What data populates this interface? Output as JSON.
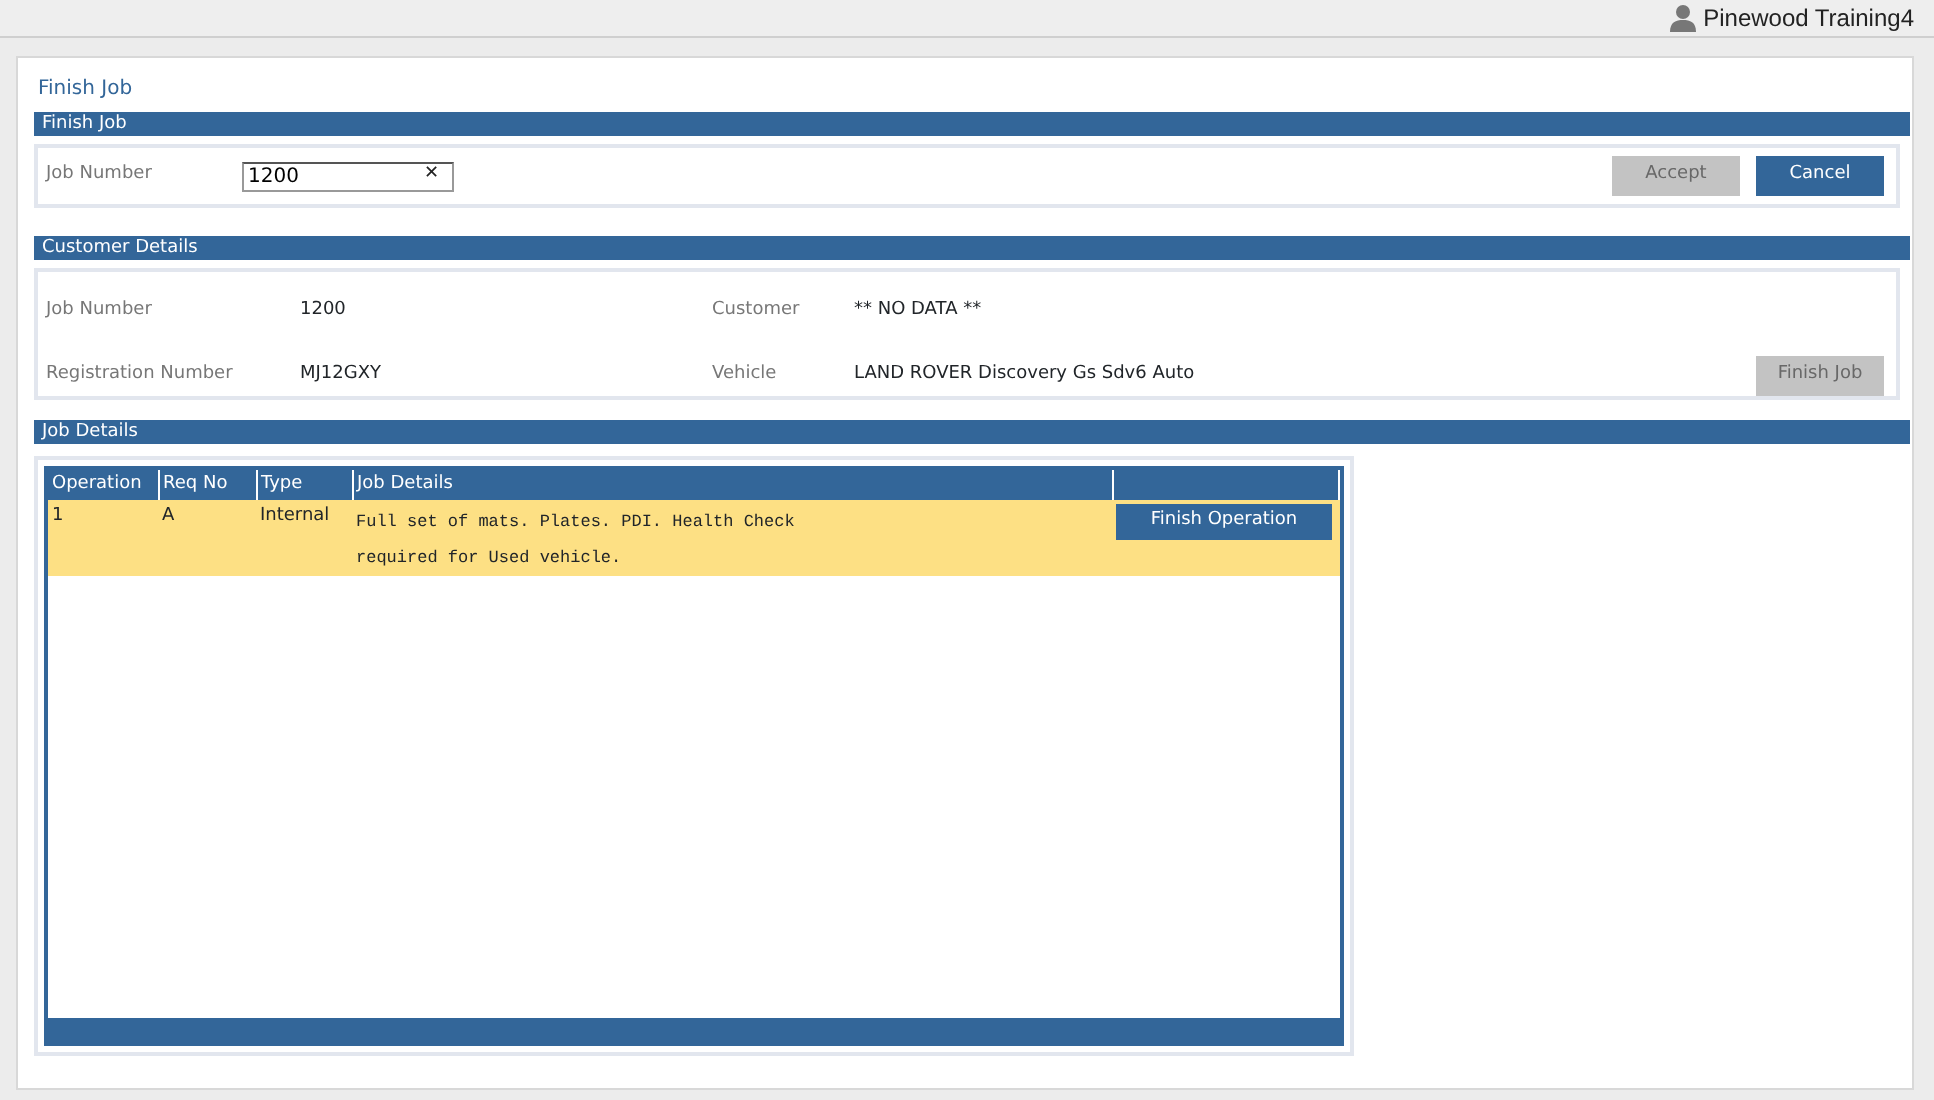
{
  "user": {
    "name": "Pinewood Training4"
  },
  "page_title": "Finish Job",
  "finish_section": {
    "title": "Finish Job",
    "field_label": "Job Number",
    "field_value": "1200",
    "clear": "✕",
    "buttons": [
      {
        "label": "Accept",
        "disabled": true
      },
      {
        "label": "Cancel",
        "disabled": false
      }
    ]
  },
  "customer_section": {
    "title": "Customer Details",
    "fields": [
      {
        "label": "Job Number",
        "value": "1200"
      },
      {
        "label": "Customer",
        "value": "** NO DATA **"
      },
      {
        "label": "Registration Number",
        "value": "MJ12GXY"
      },
      {
        "label": "Vehicle",
        "value": "LAND ROVER Discovery Gs Sdv6 Auto"
      }
    ],
    "button": {
      "label": "Finish Job",
      "disabled": true
    }
  },
  "job_section": {
    "title": "Job Details",
    "table": {
      "columns": [
        "Operation",
        "Req No",
        "Type",
        "Job Details"
      ],
      "rows": [
        {
          "operation": "1",
          "req_no": "A",
          "type": "Internal",
          "details": "Full set of mats. Plates. PDI. Health Check required for Used vehicle.",
          "selected": true,
          "action": "Finish Operation"
        }
      ]
    }
  }
}
